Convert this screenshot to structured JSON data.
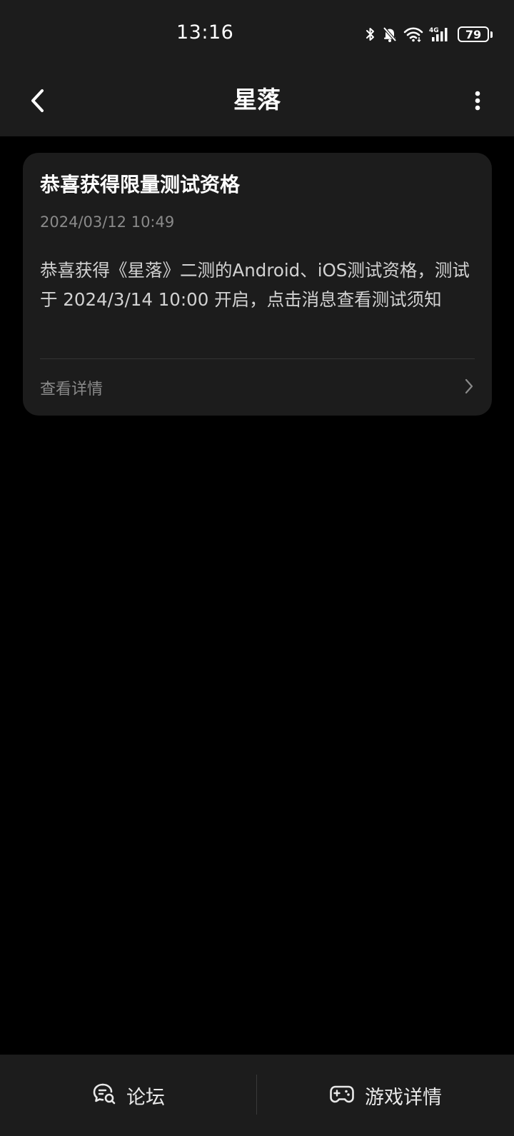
{
  "status_bar": {
    "time": "13:16",
    "battery_level": "79",
    "icons": [
      "bluetooth-icon",
      "mute-bell-icon",
      "wifi-icon",
      "cellular-4g-icon",
      "battery-icon"
    ]
  },
  "header": {
    "title": "星落",
    "back_icon": "chevron-left-icon",
    "more_icon": "more-vertical-icon"
  },
  "message": {
    "title": "恭喜获得限量测试资格",
    "date": "2024/03/12 10:49",
    "body": "恭喜获得《星落》二测的Android、iOS测试资格，测试于 2024/3/14 10:00 开启，点击消息查看测试须知",
    "link_label": "查看详情",
    "link_icon": "chevron-right-icon"
  },
  "bottom_bar": {
    "tabs": [
      {
        "label": "论坛",
        "icon": "forum-search-icon"
      },
      {
        "label": "游戏详情",
        "icon": "gamepad-icon"
      }
    ]
  },
  "colors": {
    "background": "#000000",
    "surface": "#1c1c1c",
    "text_primary": "#ffffff",
    "text_secondary": "#8a8a8a"
  }
}
